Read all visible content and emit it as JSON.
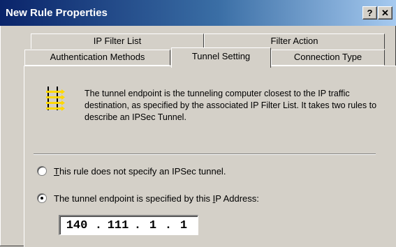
{
  "window": {
    "title": "New Rule Properties",
    "help_label": "?",
    "close_label": "✕"
  },
  "tabs": {
    "ip_filter_list": "IP Filter List",
    "filter_action": "Filter Action",
    "authentication_methods": "Authentication Methods",
    "tunnel_setting": "Tunnel Setting",
    "connection_type": "Connection Type",
    "active": "Tunnel Setting"
  },
  "panel": {
    "icon": "tunnel-icon",
    "description": "The tunnel endpoint is the tunneling computer closest to the IP traffic destination, as specified by the associated IP Filter List. It takes two rules to describe an IPSec Tunnel.",
    "options": [
      {
        "pre": "",
        "mnemonic": "T",
        "post": "his rule does not specify an IPSec tunnel.",
        "checked": false
      },
      {
        "pre": "The tunnel endpoint is specified by this ",
        "mnemonic": "I",
        "post": "P Address:",
        "checked": true
      }
    ],
    "ip_address": {
      "octets": [
        "140",
        "111",
        "1",
        "1"
      ],
      "separator": "."
    }
  }
}
